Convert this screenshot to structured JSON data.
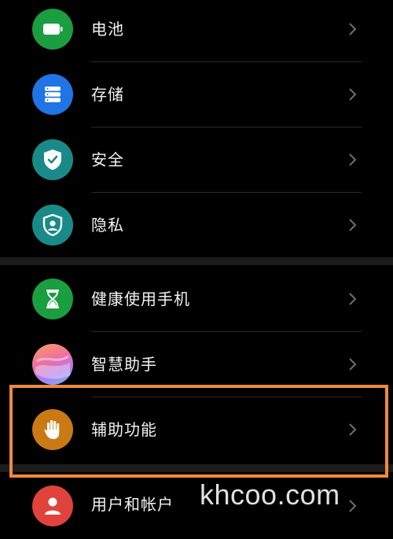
{
  "settings": {
    "items": [
      {
        "label": "电池",
        "icon": "battery-icon",
        "color": "#1a9e3f"
      },
      {
        "label": "存储",
        "icon": "storage-icon",
        "color": "#1f74e6"
      },
      {
        "label": "安全",
        "icon": "shield-check-icon",
        "color": "#1a8a88"
      },
      {
        "label": "隐私",
        "icon": "privacy-shield-icon",
        "color": "#1a8a88"
      },
      {
        "label": "健康使用手机",
        "icon": "hourglass-icon",
        "color": "#1a9e3f"
      },
      {
        "label": "智慧助手",
        "icon": "assistant-orb-icon",
        "color": "#e88fb6"
      },
      {
        "label": "辅助功能",
        "icon": "hand-icon",
        "color": "#c97a14"
      },
      {
        "label": "用户和帐户",
        "icon": "user-icon",
        "color": "#e0433c"
      }
    ]
  },
  "watermark": {
    "text": "khcoo.com"
  },
  "highlight": {
    "color": "#f08a3c"
  }
}
